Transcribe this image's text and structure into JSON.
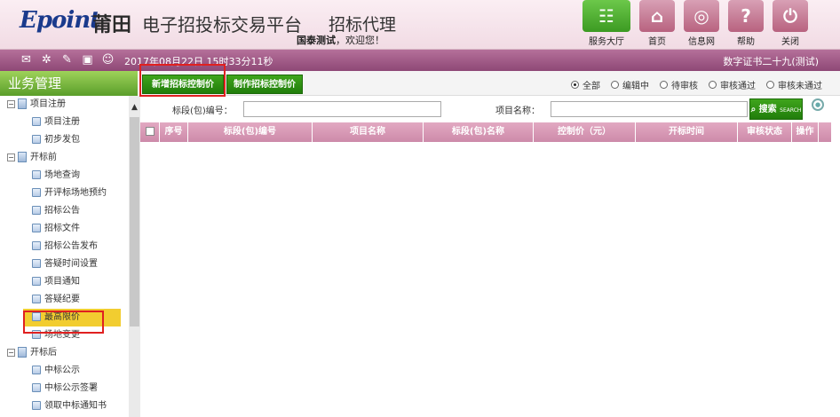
{
  "header": {
    "logo": "Epoint",
    "city": "莆田",
    "platform": "电子招投标交易平台",
    "role": "招标代理",
    "welcome_user": "国泰测试",
    "welcome_text": "，欢迎您！"
  },
  "topnav": [
    {
      "label": "服务大厅",
      "icon": "service-hall-icon"
    },
    {
      "label": "首页",
      "icon": "home-icon"
    },
    {
      "label": "信息网",
      "icon": "globe-icon"
    },
    {
      "label": "帮助",
      "icon": "help-icon"
    },
    {
      "label": "关闭",
      "icon": "power-icon"
    }
  ],
  "strip": {
    "datetime": "2017年08月22日 15时33分11秒",
    "cert": "数字证书二十九(测试)"
  },
  "sidebar": {
    "title": "业务管理",
    "items": [
      {
        "label": "项目注册",
        "type": "group"
      },
      {
        "label": "项目注册",
        "type": "leaf"
      },
      {
        "label": "初步发包",
        "type": "leaf"
      },
      {
        "label": "开标前",
        "type": "group"
      },
      {
        "label": "场地查询",
        "type": "leaf"
      },
      {
        "label": "开评标场地预约",
        "type": "leaf"
      },
      {
        "label": "招标公告",
        "type": "leaf"
      },
      {
        "label": "招标文件",
        "type": "leaf"
      },
      {
        "label": "招标公告发布",
        "type": "leaf"
      },
      {
        "label": "答疑时间设置",
        "type": "leaf"
      },
      {
        "label": "项目通知",
        "type": "leaf"
      },
      {
        "label": "答疑纪要",
        "type": "leaf"
      },
      {
        "label": "最高限价",
        "type": "leaf",
        "active": true
      },
      {
        "label": "场地变更",
        "type": "leaf"
      },
      {
        "label": "开标后",
        "type": "group"
      },
      {
        "label": "中标公示",
        "type": "leaf"
      },
      {
        "label": "中标公示签署",
        "type": "leaf"
      },
      {
        "label": "领取中标通知书",
        "type": "leaf"
      }
    ]
  },
  "toolbar": {
    "add_label": "新增招标控制价",
    "make_label": "制作招标控制价"
  },
  "filters": {
    "selected": "全部",
    "options": [
      "全部",
      "编辑中",
      "待审核",
      "审核通过",
      "审核未通过"
    ]
  },
  "search": {
    "section_label": "标段(包)编号：",
    "section_value": "",
    "project_label": "项目名称：",
    "project_value": "",
    "button_label": "搜索",
    "button_sub": "SEARCH"
  },
  "grid": {
    "columns": [
      "序号",
      "标段(包)编号",
      "项目名称",
      "标段(包)名称",
      "控制价（元）",
      "开标时间",
      "审核状态",
      "操作"
    ],
    "rows": []
  }
}
